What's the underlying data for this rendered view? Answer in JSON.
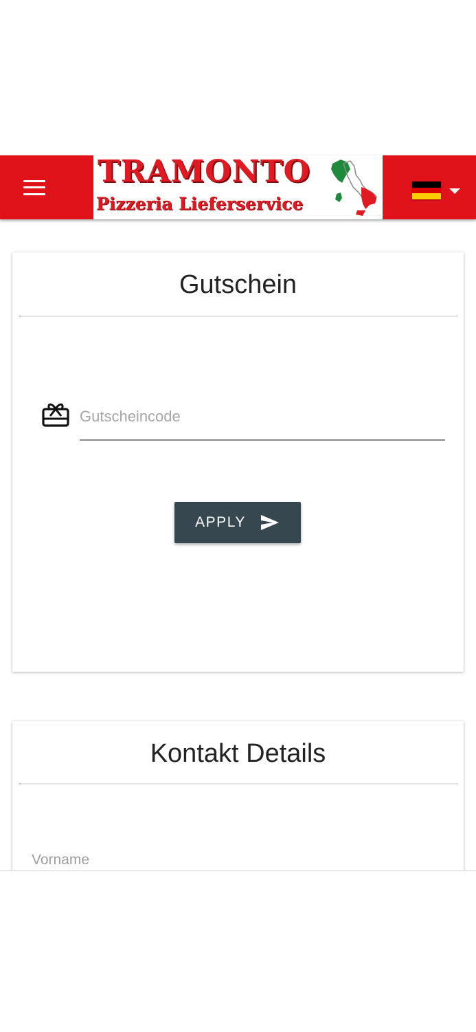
{
  "header": {
    "menu_icon": "hamburger-menu-icon",
    "logo": {
      "title": "TRAMONTO",
      "subtitle": "Pizzeria Lieferservice",
      "map_icon": "italy-map-icon"
    },
    "language": {
      "flag_icon": "germany-flag-icon",
      "dropdown_icon": "caret-down-icon"
    },
    "colors": {
      "header_bg": "#e0121a",
      "logo_text": "#e01a22"
    }
  },
  "voucher_card": {
    "title": "Gutschein",
    "icon": "gift-card-icon",
    "code_input": {
      "placeholder": "Gutscheincode",
      "value": ""
    },
    "apply_button": {
      "label": "APPLY",
      "icon": "send-icon",
      "color": "#37474f"
    }
  },
  "contact_card": {
    "title": "Kontakt Details",
    "first_name_label": "Vorname"
  }
}
